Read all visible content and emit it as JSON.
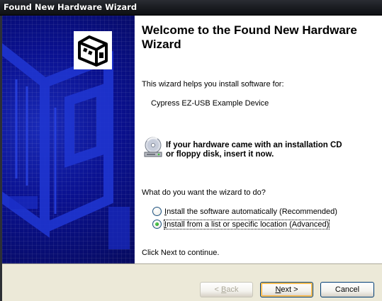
{
  "window": {
    "title": "Found New Hardware Wizard"
  },
  "content": {
    "heading": "Welcome to the Found New Hardware Wizard",
    "intro": "This wizard helps you install software for:",
    "device_name": "Cypress EZ-USB Example Device",
    "cd_message_line1": "If your hardware came with an installation CD",
    "cd_message_line2": "or floppy disk, insert it now.",
    "question": "What do you want the wizard to do?",
    "options": [
      {
        "mnemonic": "I",
        "rest": "nstall the software automatically (Recommended)",
        "selected": false
      },
      {
        "mnemonic": "I",
        "rest": "nstall from a list or specific location (Advanced)",
        "selected": true
      }
    ],
    "continue_hint": "Click Next to continue."
  },
  "buttons": {
    "back_prefix": "< ",
    "back_mnemonic": "B",
    "back_rest": "ack",
    "next_mnemonic": "N",
    "next_rest": "ext >",
    "cancel": "Cancel"
  },
  "icons": {
    "banner": "hardware-card-icon",
    "cd": "cd-drive-icon"
  },
  "colors": {
    "banner_blue": "#0a0f7a",
    "titlebar": "#1a1c21",
    "footer": "#ece9d8"
  }
}
